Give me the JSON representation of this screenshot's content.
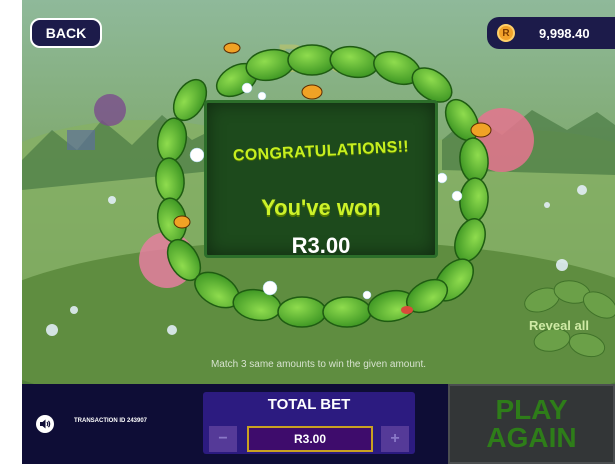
{
  "header": {
    "back_label": "BACK",
    "balance": "9,998.40",
    "coin_symbol": "R"
  },
  "win": {
    "congrats": "CONGRATULATIONS!!",
    "you_won": "You've won",
    "prize": "R3.00"
  },
  "instruction": "Match 3 same amounts to win the given amount.",
  "reveal_all_label": "Reveal all",
  "footer": {
    "transaction": "TRANSACTION ID 243907",
    "total_bet_label": "TOTAL BET",
    "bet_value": "R3.00",
    "minus": "−",
    "plus": "+",
    "play_again_line1": "PLAY",
    "play_again_line2": "AGAIN"
  },
  "colors": {
    "bar_bg": "#0e0d36",
    "panel_bg": "#1d4a1c",
    "accent_text": "#cdf22a",
    "bet_box": "#2c1b80"
  },
  "icons": {
    "sound": "speaker-icon",
    "coin": "coin-icon"
  }
}
